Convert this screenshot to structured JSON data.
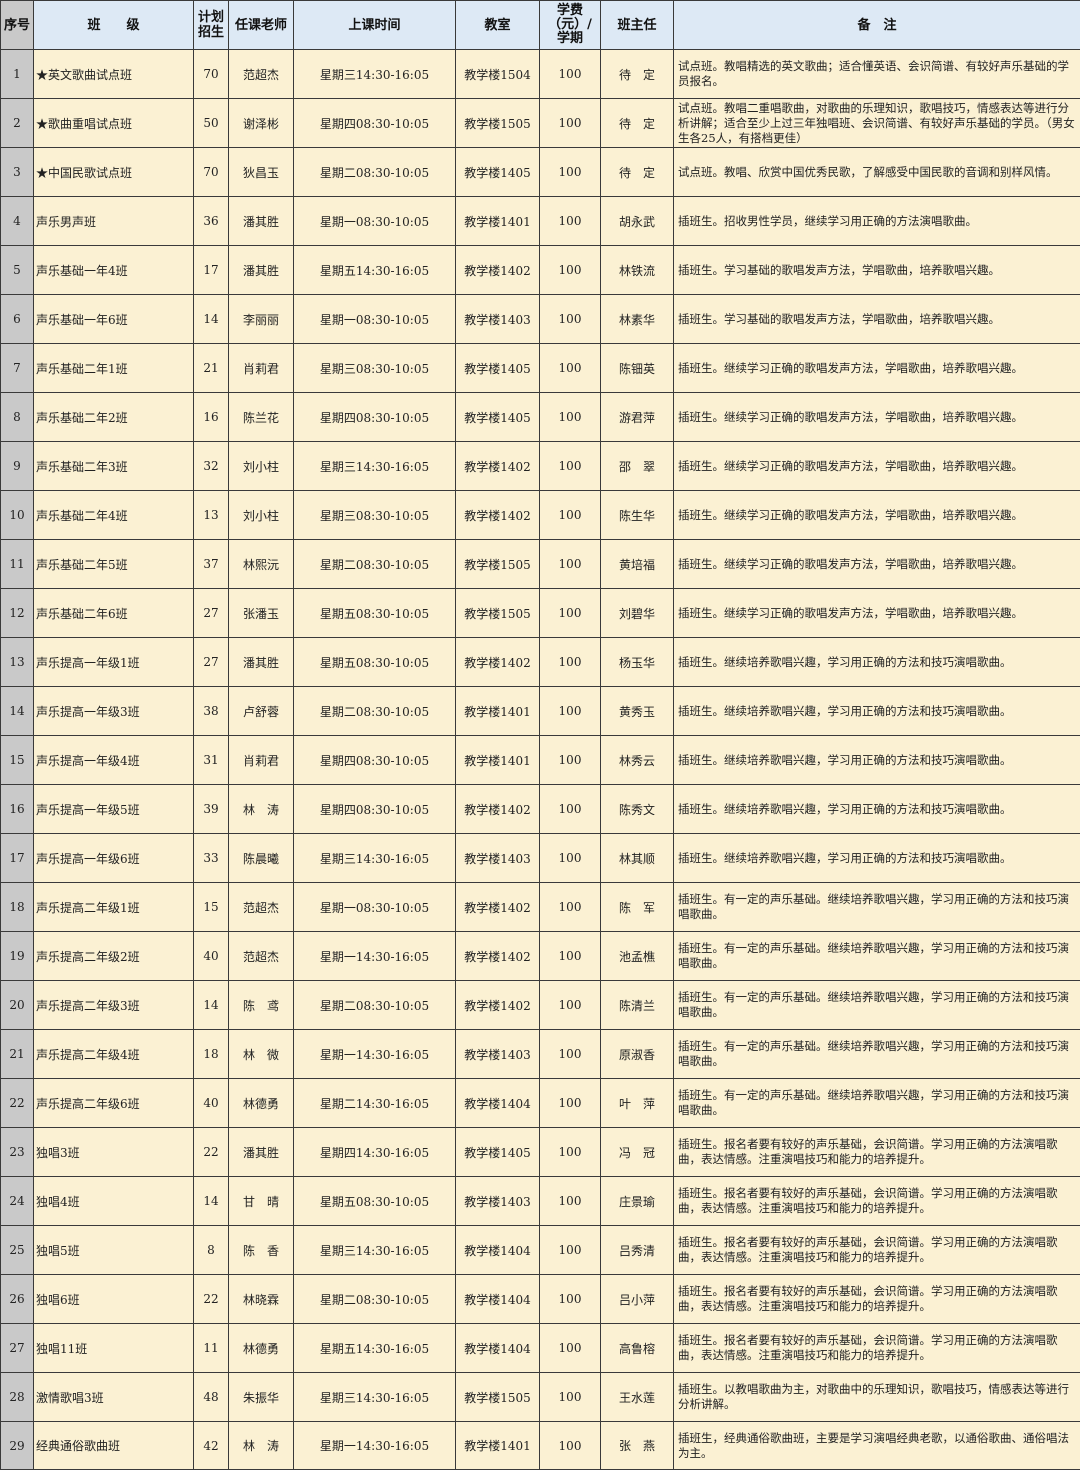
{
  "table": {
    "headers": {
      "index": "序号",
      "class": "班　　级",
      "planned": "计划\n招生",
      "teacher": "任课老师",
      "time": "上课时间",
      "room": "教室",
      "fee": "学费\n（元）/\n学期",
      "headteacher": "班主任",
      "note": "备　注"
    },
    "rows": [
      {
        "no": "1",
        "class": "★英文歌曲试点班",
        "planned": "70",
        "teacher": "范超杰",
        "time": "星期三14:30-16:05",
        "room": "教学楼1504",
        "fee": "100",
        "head": "待　定",
        "note": "试点班。教唱精选的英文歌曲；适合懂英语、会识简谱、有较好声乐基础的学员报名。"
      },
      {
        "no": "2",
        "class": "★歌曲重唱试点班",
        "planned": "50",
        "teacher": "谢泽彬",
        "time": "星期四08:30-10:05",
        "room": "教学楼1505",
        "fee": "100",
        "head": "待　定",
        "note": "试点班。教唱二重唱歌曲，对歌曲的乐理知识，歌唱技巧，情感表达等进行分析讲解；适合至少上过三年独唱班、会识简谱、有较好声乐基础的学员。（男女生各25人，有搭档更佳）"
      },
      {
        "no": "3",
        "class": "★中国民歌试点班",
        "planned": "70",
        "teacher": "狄昌玉",
        "time": "星期二08:30-10:05",
        "room": "教学楼1405",
        "fee": "100",
        "head": "待　定",
        "note": "试点班。教唱、欣赏中国优秀民歌，了解感受中国民歌的音调和别样风情。"
      },
      {
        "no": "4",
        "class": "声乐男声班",
        "planned": "36",
        "teacher": "潘其胜",
        "time": "星期一08:30-10:05",
        "room": "教学楼1401",
        "fee": "100",
        "head": "胡永武",
        "note": "插班生。招收男性学员，继续学习用正确的方法演唱歌曲。"
      },
      {
        "no": "5",
        "class": "声乐基础一年4班",
        "planned": "17",
        "teacher": "潘其胜",
        "time": "星期五14:30-16:05",
        "room": "教学楼1402",
        "fee": "100",
        "head": "林铁流",
        "note": "插班生。学习基础的歌唱发声方法，学唱歌曲，培养歌唱兴趣。"
      },
      {
        "no": "6",
        "class": "声乐基础一年6班",
        "planned": "14",
        "teacher": "李丽丽",
        "time": "星期一08:30-10:05",
        "room": "教学楼1403",
        "fee": "100",
        "head": "林素华",
        "note": "插班生。学习基础的歌唱发声方法，学唱歌曲，培养歌唱兴趣。"
      },
      {
        "no": "7",
        "class": "声乐基础二年1班",
        "planned": "21",
        "teacher": "肖莉君",
        "time": "星期三08:30-10:05",
        "room": "教学楼1405",
        "fee": "100",
        "head": "陈钿英",
        "note": "插班生。继续学习正确的歌唱发声方法，学唱歌曲，培养歌唱兴趣。"
      },
      {
        "no": "8",
        "class": "声乐基础二年2班",
        "planned": "16",
        "teacher": "陈兰花",
        "time": "星期四08:30-10:05",
        "room": "教学楼1405",
        "fee": "100",
        "head": "游君萍",
        "note": "插班生。继续学习正确的歌唱发声方法，学唱歌曲，培养歌唱兴趣。"
      },
      {
        "no": "9",
        "class": "声乐基础二年3班",
        "planned": "32",
        "teacher": "刘小柱",
        "time": "星期三14:30-16:05",
        "room": "教学楼1402",
        "fee": "100",
        "head": "邵　翠",
        "note": "插班生。继续学习正确的歌唱发声方法，学唱歌曲，培养歌唱兴趣。"
      },
      {
        "no": "10",
        "class": "声乐基础二年4班",
        "planned": "13",
        "teacher": "刘小柱",
        "time": "星期三08:30-10:05",
        "room": "教学楼1402",
        "fee": "100",
        "head": "陈生华",
        "note": "插班生。继续学习正确的歌唱发声方法，学唱歌曲，培养歌唱兴趣。"
      },
      {
        "no": "11",
        "class": "声乐基础二年5班",
        "planned": "37",
        "teacher": "林熙沅",
        "time": "星期二08:30-10:05",
        "room": "教学楼1505",
        "fee": "100",
        "head": "黄培福",
        "note": "插班生。继续学习正确的歌唱发声方法，学唱歌曲，培养歌唱兴趣。"
      },
      {
        "no": "12",
        "class": "声乐基础二年6班",
        "planned": "27",
        "teacher": "张潘玉",
        "time": "星期五08:30-10:05",
        "room": "教学楼1505",
        "fee": "100",
        "head": "刘碧华",
        "note": "插班生。继续学习正确的歌唱发声方法，学唱歌曲，培养歌唱兴趣。"
      },
      {
        "no": "13",
        "class": "声乐提高一年级1班",
        "planned": "27",
        "teacher": "潘其胜",
        "time": "星期五08:30-10:05",
        "room": "教学楼1402",
        "fee": "100",
        "head": "杨玉华",
        "note": "插班生。继续培养歌唱兴趣，学习用正确的方法和技巧演唱歌曲。"
      },
      {
        "no": "14",
        "class": "声乐提高一年级3班",
        "planned": "38",
        "teacher": "卢舒蓉",
        "time": "星期二08:30-10:05",
        "room": "教学楼1401",
        "fee": "100",
        "head": "黄秀玉",
        "note": "插班生。继续培养歌唱兴趣，学习用正确的方法和技巧演唱歌曲。"
      },
      {
        "no": "15",
        "class": "声乐提高一年级4班",
        "planned": "31",
        "teacher": "肖莉君",
        "time": "星期四08:30-10:05",
        "room": "教学楼1401",
        "fee": "100",
        "head": "林秀云",
        "note": "插班生。继续培养歌唱兴趣，学习用正确的方法和技巧演唱歌曲。"
      },
      {
        "no": "16",
        "class": "声乐提高一年级5班",
        "planned": "39",
        "teacher": "林　涛",
        "time": "星期四08:30-10:05",
        "room": "教学楼1402",
        "fee": "100",
        "head": "陈秀文",
        "note": "插班生。继续培养歌唱兴趣，学习用正确的方法和技巧演唱歌曲。"
      },
      {
        "no": "17",
        "class": "声乐提高一年级6班",
        "planned": "33",
        "teacher": "陈晨曦",
        "time": "星期三14:30-16:05",
        "room": "教学楼1403",
        "fee": "100",
        "head": "林其顺",
        "note": "插班生。继续培养歌唱兴趣，学习用正确的方法和技巧演唱歌曲。"
      },
      {
        "no": "18",
        "class": "声乐提高二年级1班",
        "planned": "15",
        "teacher": "范超杰",
        "time": "星期一08:30-10:05",
        "room": "教学楼1402",
        "fee": "100",
        "head": "陈　军",
        "note": "插班生。有一定的声乐基础。继续培养歌唱兴趣，学习用正确的方法和技巧演唱歌曲。"
      },
      {
        "no": "19",
        "class": "声乐提高二年级2班",
        "planned": "40",
        "teacher": "范超杰",
        "time": "星期一14:30-16:05",
        "room": "教学楼1402",
        "fee": "100",
        "head": "池孟樵",
        "note": "插班生。有一定的声乐基础。继续培养歌唱兴趣，学习用正确的方法和技巧演唱歌曲。"
      },
      {
        "no": "20",
        "class": "声乐提高二年级3班",
        "planned": "14",
        "teacher": "陈　鸢",
        "time": "星期二08:30-10:05",
        "room": "教学楼1402",
        "fee": "100",
        "head": "陈清兰",
        "note": "插班生。有一定的声乐基础。继续培养歌唱兴趣，学习用正确的方法和技巧演唱歌曲。"
      },
      {
        "no": "21",
        "class": "声乐提高二年级4班",
        "planned": "18",
        "teacher": "林　微",
        "time": "星期一14:30-16:05",
        "room": "教学楼1403",
        "fee": "100",
        "head": "原淑香",
        "note": "插班生。有一定的声乐基础。继续培养歌唱兴趣，学习用正确的方法和技巧演唱歌曲。"
      },
      {
        "no": "22",
        "class": "声乐提高二年级6班",
        "planned": "40",
        "teacher": "林德勇",
        "time": "星期二14:30-16:05",
        "room": "教学楼1404",
        "fee": "100",
        "head": "叶　萍",
        "note": "插班生。有一定的声乐基础。继续培养歌唱兴趣，学习用正确的方法和技巧演唱歌曲。"
      },
      {
        "no": "23",
        "class": "独唱3班",
        "planned": "22",
        "teacher": "潘其胜",
        "time": "星期四14:30-16:05",
        "room": "教学楼1405",
        "fee": "100",
        "head": "冯　冠",
        "note": "插班生。报名者要有较好的声乐基础，会识简谱。学习用正确的方法演唱歌曲，表达情感。注重演唱技巧和能力的培养提升。"
      },
      {
        "no": "24",
        "class": "独唱4班",
        "planned": "14",
        "teacher": "甘　晴",
        "time": "星期五08:30-10:05",
        "room": "教学楼1403",
        "fee": "100",
        "head": "庄景瑜",
        "note": "插班生。报名者要有较好的声乐基础，会识简谱。学习用正确的方法演唱歌曲，表达情感。注重演唱技巧和能力的培养提升。"
      },
      {
        "no": "25",
        "class": "独唱5班",
        "planned": "8",
        "teacher": "陈　香",
        "time": "星期三14:30-16:05",
        "room": "教学楼1404",
        "fee": "100",
        "head": "吕秀清",
        "note": "插班生。报名者要有较好的声乐基础，会识简谱。学习用正确的方法演唱歌曲，表达情感。注重演唱技巧和能力的培养提升。"
      },
      {
        "no": "26",
        "class": "独唱6班",
        "planned": "22",
        "teacher": "林晓霖",
        "time": "星期二08:30-10:05",
        "room": "教学楼1404",
        "fee": "100",
        "head": "吕小萍",
        "note": "插班生。报名者要有较好的声乐基础，会识简谱。学习用正确的方法演唱歌曲，表达情感。注重演唱技巧和能力的培养提升。"
      },
      {
        "no": "27",
        "class": "独唱11班",
        "planned": "11",
        "teacher": "林德勇",
        "time": "星期五14:30-16:05",
        "room": "教学楼1404",
        "fee": "100",
        "head": "高鲁榕",
        "note": "插班生。报名者要有较好的声乐基础，会识简谱。学习用正确的方法演唱歌曲，表达情感。注重演唱技巧和能力的培养提升。"
      },
      {
        "no": "28",
        "class": "激情歌唱3班",
        "planned": "48",
        "teacher": "朱振华",
        "time": "星期三14:30-16:05",
        "room": "教学楼1505",
        "fee": "100",
        "head": "王水莲",
        "note": "插班生。以教唱歌曲为主，对歌曲中的乐理知识，歌唱技巧，情感表达等进行分析讲解。"
      },
      {
        "no": "29",
        "class": "经典通俗歌曲班",
        "planned": "42",
        "teacher": "林　涛",
        "time": "星期一14:30-16:05",
        "room": "教学楼1401",
        "fee": "100",
        "head": "张　燕",
        "note": "插班生，经典通俗歌曲班，主要是学习演唱经典老歌，以通俗歌曲、通俗唱法为主。"
      }
    ]
  }
}
